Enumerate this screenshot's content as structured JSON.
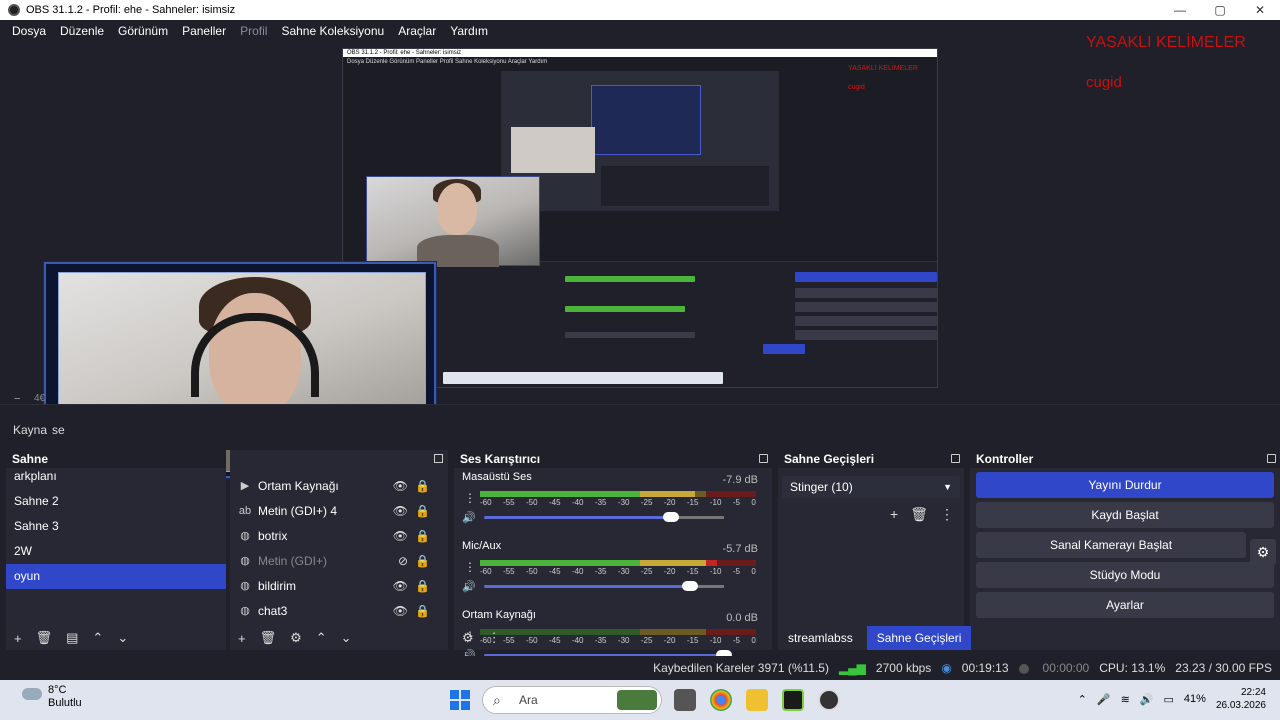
{
  "window": {
    "title": "OBS 31.1.2 - Profil: ehe - Sahneler: isimsiz",
    "min": "—",
    "max": "▢",
    "close": "✕"
  },
  "menu": {
    "items": [
      "Dosya",
      "Düzenle",
      "Görünüm",
      "Paneller",
      "Profil",
      "Sahne Koleksiyonu",
      "Araçlar",
      "Yardım"
    ]
  },
  "overlay": {
    "title": "YASAKLI KELİMELER",
    "word": "cugid"
  },
  "nested": {
    "title": "OBS 31.1.2 - Profil: ehe - Sahneler: isimsiz",
    "menu": "Dosya   Düzenle   Görünüm   Paneller   Profil   Sahne Koleksiyonu   Araçlar   Yardım",
    "red_title": "YASAKLI KELİMELER",
    "red_word": "cugid"
  },
  "preview_strip": {
    "minus": "−",
    "partial": "4€",
    "sources_label_partial": "Kayna",
    "sources_label_tail": "se"
  },
  "scenes": {
    "header": "Sahne",
    "items": [
      "arkplanı",
      "Sahne 2",
      "Sahne 3",
      "2W",
      "oyun"
    ],
    "selected_index": 4
  },
  "sources": {
    "items": [
      {
        "label": "Ortam Kaynağı",
        "icon": "speaker-icon",
        "visible": true
      },
      {
        "label": "Metin (GDI+) 4",
        "icon": "text-icon",
        "visible": true
      },
      {
        "label": "botrix",
        "icon": "globe-icon",
        "visible": true
      },
      {
        "label": "Metin (GDI+)",
        "icon": "globe-icon",
        "visible": false
      },
      {
        "label": "bildirim",
        "icon": "globe-icon",
        "visible": true
      },
      {
        "label": "chat3",
        "icon": "globe-icon",
        "visible": true
      }
    ]
  },
  "mixer": {
    "header": "Ses Karıştırıcı",
    "channels": [
      {
        "name": "Masaüstü Ses",
        "db": "-7.9 dB",
        "level": 0.78,
        "volume": 0.78
      },
      {
        "name": "Mic/Aux",
        "db": "-5.7 dB",
        "level": 0.86,
        "volume": 0.86
      },
      {
        "name": "Ortam Kaynağı",
        "db": "0.0 dB",
        "level": 0.0,
        "volume": 1.0
      }
    ],
    "ticks": [
      "-60",
      "-55",
      "-50",
      "-45",
      "-40",
      "-35",
      "-30",
      "-25",
      "-20",
      "-15",
      "-10",
      "-5",
      "0"
    ]
  },
  "transitions": {
    "header": "Sahne Geçişleri",
    "selected": "Stinger (10)"
  },
  "controls": {
    "header": "Kontroller",
    "buttons": [
      "Yayını Durdur",
      "Kaydı Başlat",
      "Sanal Kamerayı Başlat",
      "Stüdyo Modu",
      "Ayarlar"
    ]
  },
  "tabs": [
    "streamlabss",
    "Sahne Geçişleri"
  ],
  "status": {
    "dropped": "Kaybedilen Kareler 3971 (%11.5)",
    "bitrate": "2700 kbps",
    "stream_time": "00:19:13",
    "rec_time": "00:00:00",
    "cpu": "CPU: 13.1%",
    "fps": "23.23 / 30.00 FPS"
  },
  "taskbar": {
    "temp": "8°C",
    "weather": "Bulutlu",
    "search": "Ara",
    "battery": "41%",
    "time": "22:24",
    "date": "26.03.2026"
  },
  "colors": {
    "accent": "#2f47c8",
    "bg": "#1f2029",
    "panel": "#272833",
    "red_text": "#c81010"
  }
}
